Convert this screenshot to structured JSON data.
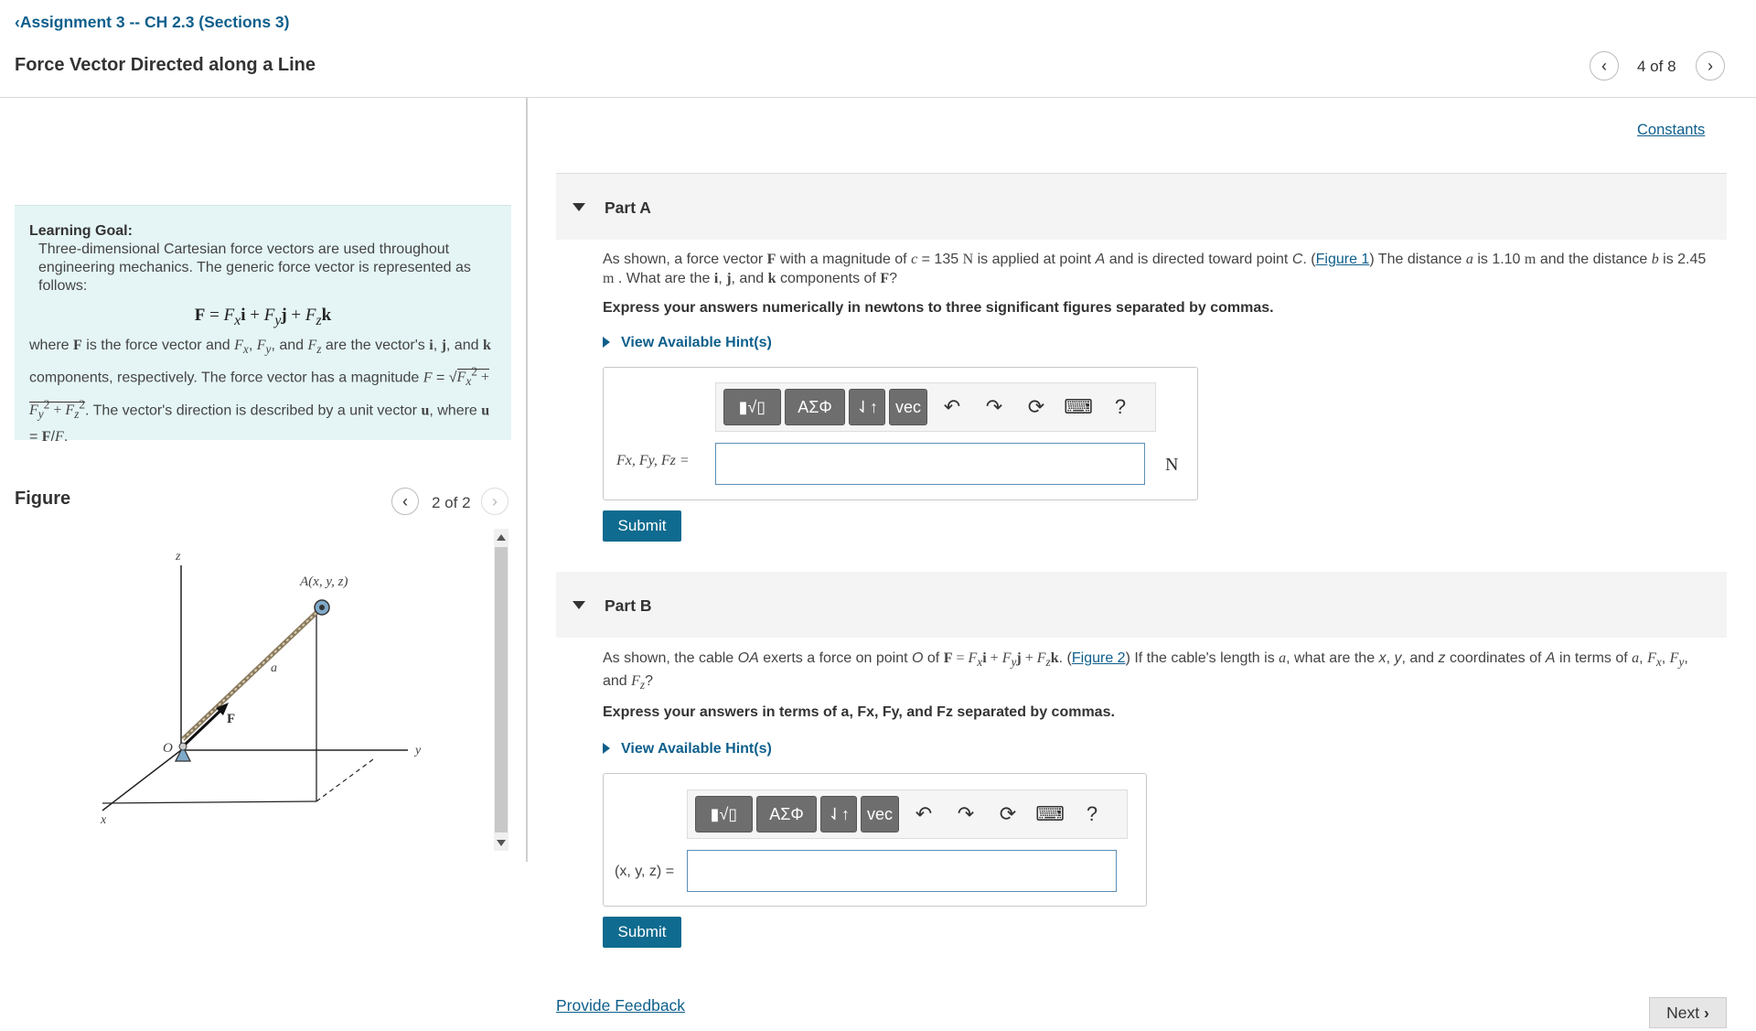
{
  "header": {
    "back_link": "Assignment 3 -- CH 2.3 (Sections 3)",
    "title": "Force Vector Directed along a Line",
    "item_counter": "4 of 8"
  },
  "learning_goal": {
    "title": "Learning Goal:",
    "intro": "Three-dimensional Cartesian force vectors are used throughout engineering mechanics. The generic force vector is represented as follows:",
    "formula": "F = Fxi + Fyj + Fzk",
    "body_1": "where",
    "body_2": "is the force vector and",
    "body_3": "are the vector's",
    "body_4": "components, respectively. The force vector has a magnitude",
    "body_5": "The vector's direction is described by a unit vector",
    "body_6": ", where"
  },
  "figure": {
    "title": "Figure",
    "counter": "2 of 2",
    "labels": {
      "z": "z",
      "y": "y",
      "x": "x",
      "o": "O",
      "a_point": "A(x, y, z)",
      "a": "a",
      "f": "F"
    }
  },
  "constants_link": "Constants",
  "part_a": {
    "title": "Part A",
    "question_1": "As shown, a force vector",
    "question_2": "with a magnitude of",
    "question_3": "= 135",
    "question_4": "is applied at point",
    "question_5": "and is directed toward point",
    "question_6": "(",
    "figure_link": "Figure 1",
    "question_7": ") The distance",
    "question_8": "is 1.10",
    "question_9": "and the distance",
    "question_10": "is 2.45",
    "question_11": ". What are the",
    "question_12": "and",
    "question_13": "components of",
    "express": "Express your answers numerically in newtons to three significant figures separated by commas.",
    "hint": "View Available Hint(s)",
    "answer_label": "Fx, Fy, Fz =",
    "unit": "N",
    "submit": "Submit"
  },
  "part_b": {
    "title": "Part B",
    "question_1": "As shown, the cable",
    "question_2": "exerts a force on point",
    "question_3": "of",
    "question_4": "(",
    "figure_link": "Figure 2",
    "question_5": ") If the cable's length is",
    "question_6": ", what are the",
    "question_7": "coordinates of",
    "question_8": "in terms of",
    "express": "Express your answers in terms of a, Fx, Fy, and Fz separated by commas.",
    "hint": "View Available Hint(s)",
    "answer_label": "(x, y, z) =",
    "submit": "Submit"
  },
  "toolbar": {
    "templates": "▮√▯",
    "greek": "ΑΣΦ",
    "arrows": "⇃↑",
    "vec": "vec",
    "undo": "↶",
    "redo": "↷",
    "reset": "⟳",
    "keyboard": "⌨",
    "help": "?"
  },
  "footer": {
    "feedback": "Provide Feedback",
    "next": "Next"
  }
}
